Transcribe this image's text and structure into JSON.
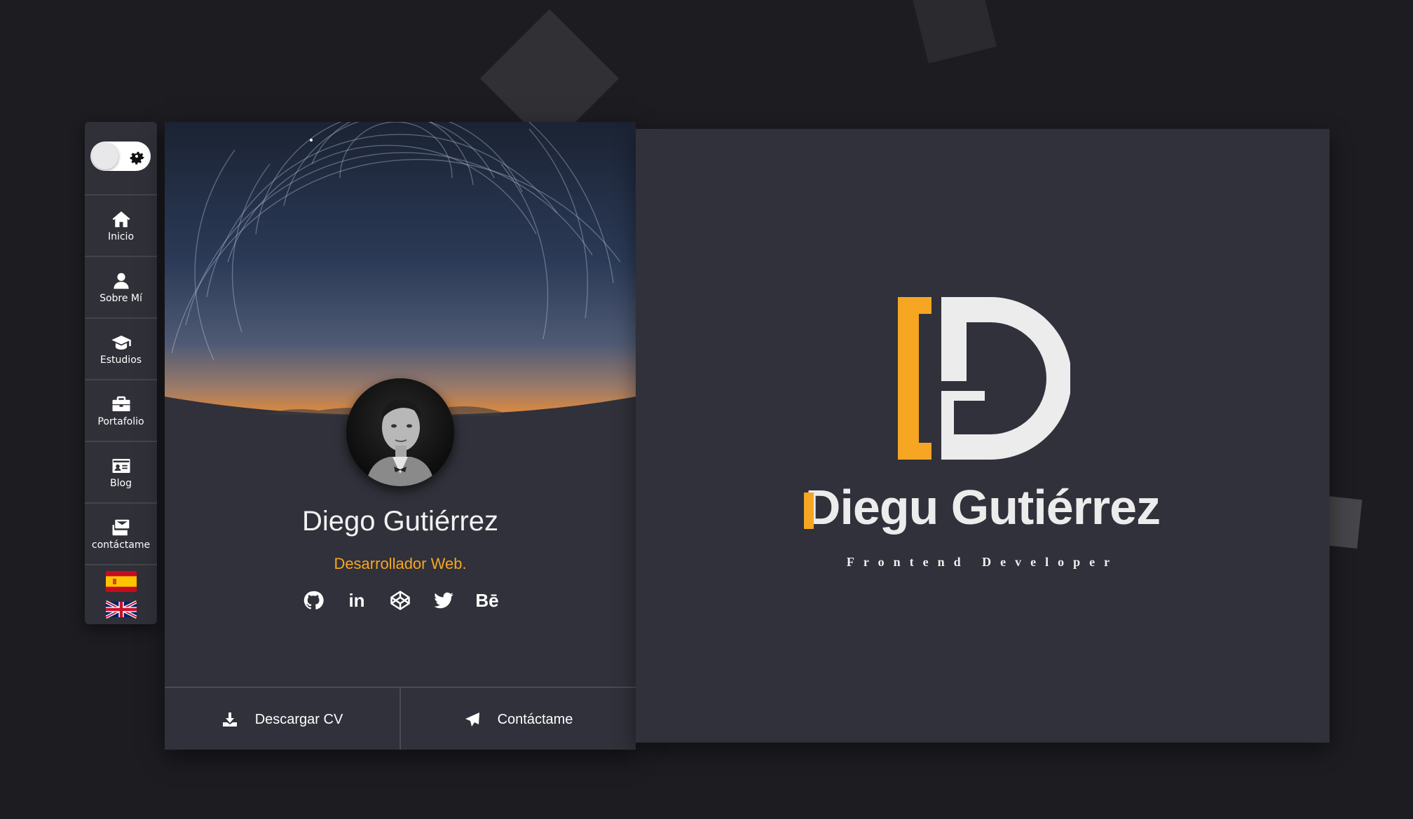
{
  "sidebar": {
    "theme_toggle_icon": "gear-icon",
    "items": [
      {
        "label": "Inicio",
        "icon": "home-icon"
      },
      {
        "label": "Sobre Mí",
        "icon": "user-icon"
      },
      {
        "label": "Estudios",
        "icon": "graduation-cap-icon"
      },
      {
        "label": "Portafolio",
        "icon": "briefcase-icon"
      },
      {
        "label": "Blog",
        "icon": "id-card-icon"
      },
      {
        "label": "contáctame",
        "icon": "envelopes-icon"
      }
    ],
    "languages": [
      "es-flag-icon",
      "uk-flag-icon"
    ]
  },
  "profile": {
    "name": "Diego Gutiérrez",
    "role": "Desarrollador Web.",
    "socials": [
      "github-icon",
      "linkedin-icon",
      "codepen-icon",
      "twitter-icon",
      "behance-icon"
    ],
    "linkedin_text": "in",
    "behance_text": "Bē",
    "actions": {
      "download_cv": "Descargar CV",
      "contact": "Contáctame"
    }
  },
  "brand": {
    "name_first": "D",
    "name_rest": "iegu Gutiérrez",
    "tagline": "Frontend Developer"
  },
  "colors": {
    "accent": "#f6a623",
    "background": "#1c1c21",
    "panel": "#30313a"
  }
}
